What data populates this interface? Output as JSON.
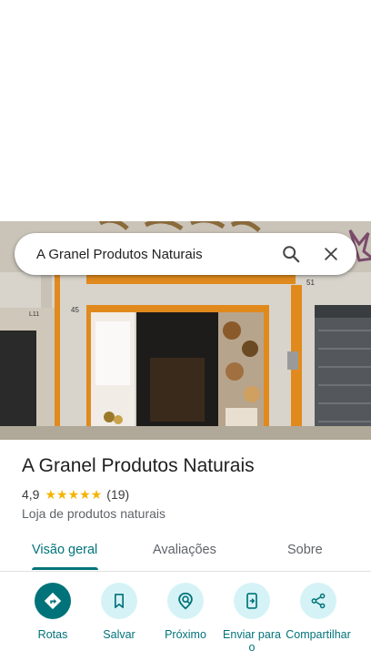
{
  "search": {
    "query": "A Granel Produtos Naturais"
  },
  "place": {
    "name": "A Granel Produtos Naturais",
    "rating": "4,9",
    "stars": [
      "★",
      "★",
      "★",
      "★",
      "★"
    ],
    "review_count": "(19)",
    "category": "Loja de produtos naturais"
  },
  "tabs": [
    {
      "label": "Visão geral",
      "active": true
    },
    {
      "label": "Avaliações",
      "active": false
    },
    {
      "label": "Sobre",
      "active": false
    }
  ],
  "actions": [
    {
      "label": "Rotas",
      "icon": "directions-icon"
    },
    {
      "label": "Salvar",
      "icon": "bookmark-icon"
    },
    {
      "label": "Próximo",
      "icon": "nearby-icon"
    },
    {
      "label": "Enviar para o",
      "icon": "send-to-phone-icon"
    },
    {
      "label": "Compartilhar",
      "icon": "share-icon"
    }
  ],
  "photo_signs": {
    "number_left": "45",
    "number_right": "51",
    "plate_left": "L11"
  },
  "colors": {
    "accent": "#00737a",
    "accent_light": "#d5f3f6",
    "star": "#f4b400",
    "storefront_trim": "#e08a1e"
  }
}
